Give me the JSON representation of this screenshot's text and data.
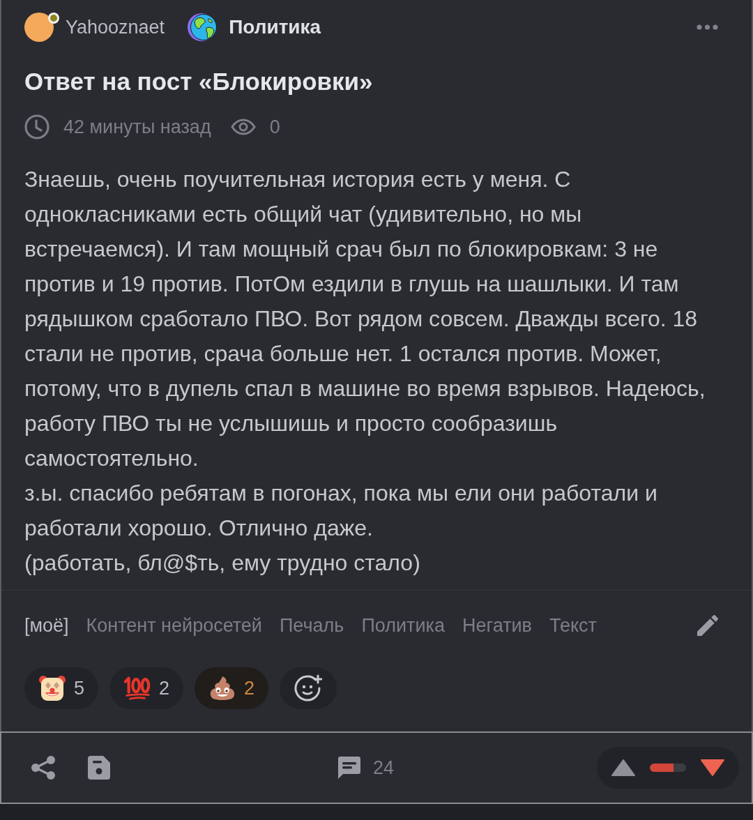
{
  "author": {
    "name": "Yahooznaet",
    "has_badge": true
  },
  "community": {
    "name": "Политика"
  },
  "post": {
    "title": "Ответ на пост «Блокировки»",
    "time": "42 минуты назад",
    "views": "0",
    "paragraphs": [
      "Знаешь, очень поучительная история есть у меня. С однокласниками есть общий чат (удивительно, но мы встречаемся). И там мощный срач был по блокировкам: 3 не против и 19 против. ПотОм ездили в глушь на шашлыки. И там рядышком сработало ПВО. Вот рядом совсем. Дважды всего. 18 стали не против, срача больше нет. 1 остался против. Может, потому, что в дупель спал в машине во время взрывов. Надеюсь, работу ПВО ты не услышишь и просто сообразишь самостоятельно.",
      "з.ы. спасибо ребятам в погонах, пока мы ели они работали и работали хорошо. Отлично даже.",
      "(работать, бл@$ть, ему трудно стало)"
    ]
  },
  "tags": [
    {
      "label": "[моё]",
      "kind": "own"
    },
    {
      "label": "Контент нейросетей",
      "kind": "tag"
    },
    {
      "label": "Печаль",
      "kind": "tag"
    },
    {
      "label": "Политика",
      "kind": "tag"
    },
    {
      "label": "Негатив",
      "kind": "tag"
    },
    {
      "label": "Текст",
      "kind": "tag"
    }
  ],
  "reactions": [
    {
      "kind": "clown",
      "count": "5",
      "selected": false
    },
    {
      "kind": "hundred",
      "count": "2",
      "selected": false
    },
    {
      "kind": "poop",
      "count": "2",
      "selected": true
    }
  ],
  "footer": {
    "comments": "24",
    "vote": {
      "upvoted": false,
      "downvoted": true,
      "level": 0.66
    }
  }
}
